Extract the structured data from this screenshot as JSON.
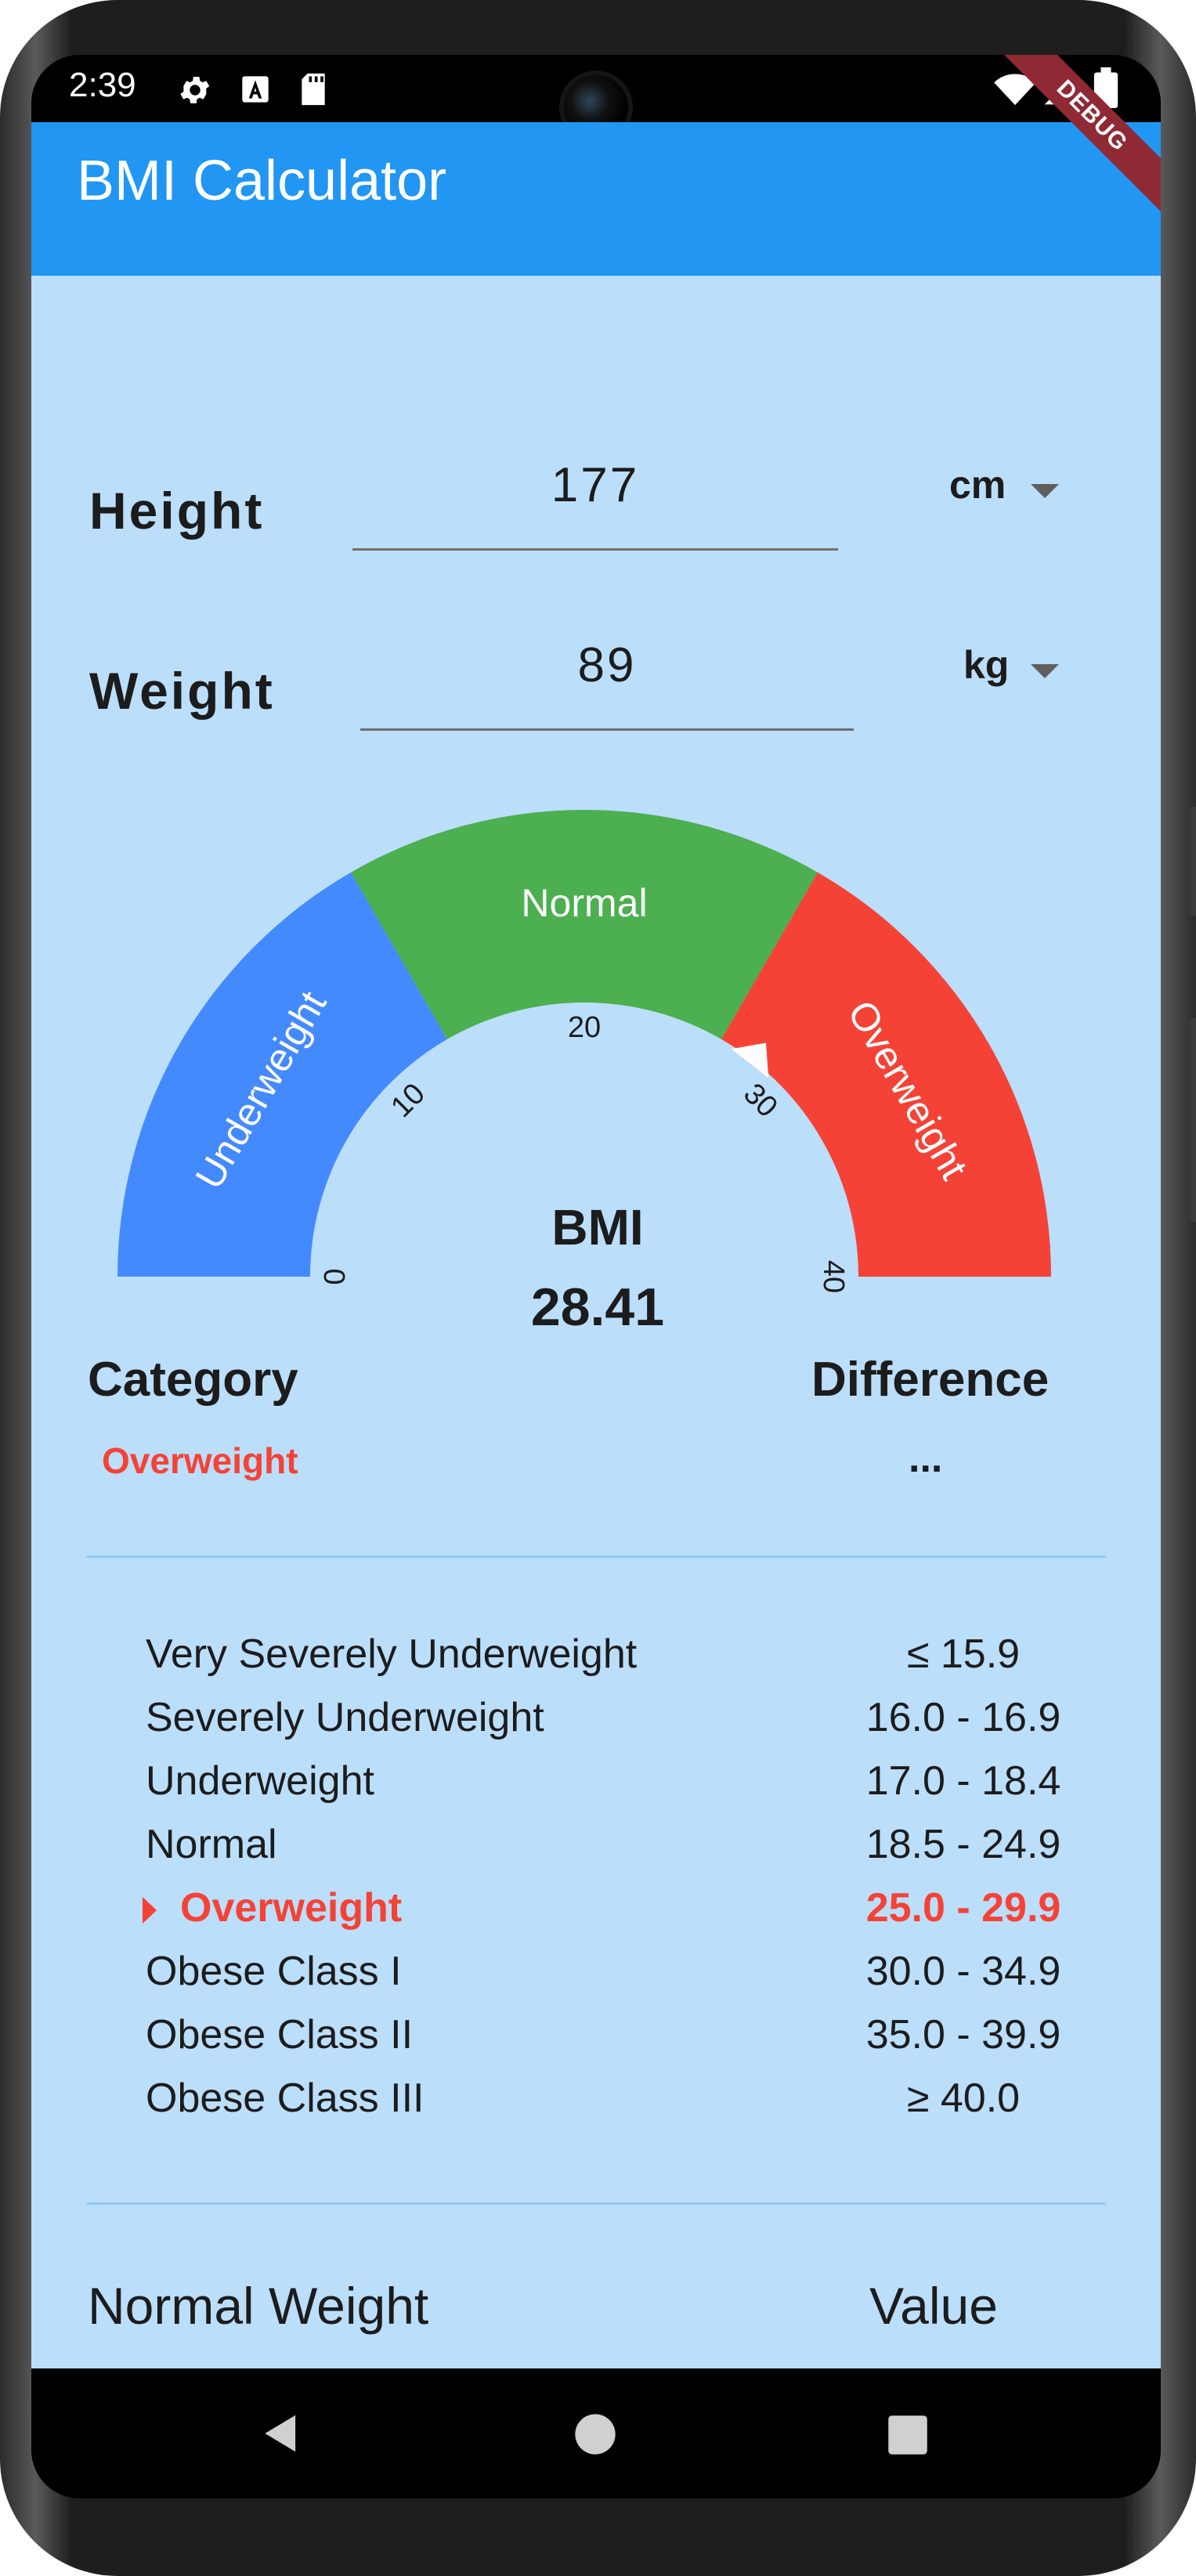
{
  "status_bar": {
    "time": "2:39",
    "icons": [
      "gear-icon",
      "text-a-icon",
      "sd-card-icon",
      "wifi-icon",
      "signal-icon",
      "battery-icon"
    ]
  },
  "debug_banner": "DEBUG",
  "app_bar": {
    "title": "BMI Calculator"
  },
  "inputs": {
    "height": {
      "label": "Height",
      "value": "177",
      "unit": "cm"
    },
    "weight": {
      "label": "Weight",
      "value": "89",
      "unit": "kg"
    }
  },
  "gauge": {
    "segments": [
      {
        "label": "Underweight",
        "color": "#448aff"
      },
      {
        "label": "Normal",
        "color": "#4caf50"
      },
      {
        "label": "Overweight",
        "color": "#f44336"
      }
    ],
    "ticks": [
      "0",
      "10",
      "20",
      "30",
      "40"
    ],
    "bmi_label": "BMI",
    "bmi_value": "28.41",
    "value": 28.41
  },
  "result": {
    "category_label": "Category",
    "category_value": "Overweight",
    "difference_label": "Difference",
    "difference_value": "..."
  },
  "table": {
    "rows": [
      {
        "name": "Very Severely Underweight",
        "range": "≤ 15.9",
        "active": false
      },
      {
        "name": "Severely Underweight",
        "range": "16.0 - 16.9",
        "active": false
      },
      {
        "name": "Underweight",
        "range": "17.0 - 18.4",
        "active": false
      },
      {
        "name": "Normal",
        "range": "18.5 - 24.9",
        "active": false
      },
      {
        "name": "Overweight",
        "range": "25.0 - 29.9",
        "active": true
      },
      {
        "name": "Obese Class I",
        "range": "30.0 - 34.9",
        "active": false
      },
      {
        "name": "Obese Class II",
        "range": "35.0 - 39.9",
        "active": false
      },
      {
        "name": "Obese Class III",
        "range": "≥ 40.0",
        "active": false
      }
    ]
  },
  "footer": {
    "normal_weight_label": "Normal Weight",
    "value_label": "Value"
  },
  "colors": {
    "app_bar": "#2196f3",
    "background": "#bbdefb",
    "accent_red": "#f44336",
    "accent_green": "#4caf50",
    "accent_blue": "#448aff"
  }
}
